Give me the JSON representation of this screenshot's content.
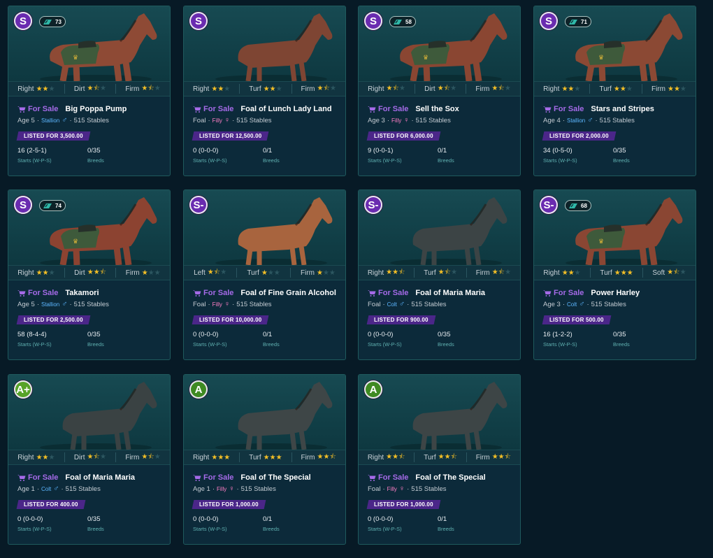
{
  "cards": [
    {
      "grade": "S",
      "rating": "73",
      "prefs": [
        [
          "Right",
          2
        ],
        [
          "Dirt",
          1.5
        ],
        [
          "Firm",
          1.5
        ]
      ],
      "sale": "For Sale",
      "name": "Big Poppa Pump",
      "age": "Age 5",
      "sex": "Stallion",
      "sex_symbol": "♂",
      "stable": "515 Stables",
      "listed": "LISTED FOR 3,500.00",
      "starts": "16 (2-5-1)",
      "starts_label": "Starts (W-P-S)",
      "breeds": "0/35",
      "breeds_label": "Breeds",
      "coat": "#8e4a35",
      "saddle": true
    },
    {
      "grade": "S",
      "rating": "",
      "prefs": [
        [
          "Right",
          2
        ],
        [
          "Turf",
          2
        ],
        [
          "Firm",
          1.5
        ]
      ],
      "sale": "For Sale",
      "name": "Foal of Lunch Lady Land",
      "age": "Foal",
      "sex": "Filly",
      "sex_symbol": "♀",
      "stable": "515 Stables",
      "listed": "LISTED FOR 12,500.00",
      "starts": "0 (0-0-0)",
      "starts_label": "Starts (W-P-S)",
      "breeds": "0/1",
      "breeds_label": "Breeds",
      "coat": "#7e4533",
      "saddle": false
    },
    {
      "grade": "S",
      "rating": "58",
      "prefs": [
        [
          "Right",
          1.5
        ],
        [
          "Dirt",
          1.5
        ],
        [
          "Firm",
          1.5
        ]
      ],
      "sale": "For Sale",
      "name": "Sell the Sox",
      "age": "Age 3",
      "sex": "Filly",
      "sex_symbol": "♀",
      "stable": "515 Stables",
      "listed": "LISTED FOR 6,000.00",
      "starts": "9 (0-0-1)",
      "starts_label": "Starts (W-P-S)",
      "breeds": "0/1",
      "breeds_label": "Breeds",
      "coat": "#8a4632",
      "saddle": true
    },
    {
      "grade": "S",
      "rating": "71",
      "prefs": [
        [
          "Right",
          2
        ],
        [
          "Turf",
          2
        ],
        [
          "Firm",
          2
        ]
      ],
      "sale": "For Sale",
      "name": "Stars and Stripes",
      "age": "Age 4",
      "sex": "Stallion",
      "sex_symbol": "♂",
      "stable": "515 Stables",
      "listed": "LISTED FOR 2,000.00",
      "starts": "34 (0-5-0)",
      "starts_label": "Starts (W-P-S)",
      "breeds": "0/35",
      "breeds_label": "Breeds",
      "coat": "#8b4934",
      "saddle": true
    },
    {
      "grade": "S",
      "rating": "74",
      "prefs": [
        [
          "Right",
          2
        ],
        [
          "Dirt",
          2.5
        ],
        [
          "Firm",
          1
        ]
      ],
      "sale": "For Sale",
      "name": "Takamori",
      "age": "Age 5",
      "sex": "Stallion",
      "sex_symbol": "♂",
      "stable": "515 Stables",
      "listed": "LISTED FOR 2,500.00",
      "starts": "58 (8-4-4)",
      "starts_label": "Starts (W-P-S)",
      "breeds": "0/35",
      "breeds_label": "Breeds",
      "coat": "#8c4331",
      "saddle": true
    },
    {
      "grade": "S-",
      "rating": "",
      "prefs": [
        [
          "Left",
          1.5
        ],
        [
          "Turf",
          1
        ],
        [
          "Firm",
          1
        ]
      ],
      "sale": "For Sale",
      "name": "Foal of Fine Grain Alcohol",
      "age": "Foal",
      "sex": "Filly",
      "sex_symbol": "♀",
      "stable": "515 Stables",
      "listed": "LISTED FOR 10,000.00",
      "starts": "0 (0-0-0)",
      "starts_label": "Starts (W-P-S)",
      "breeds": "0/1",
      "breeds_label": "Breeds",
      "coat": "#a8643e",
      "saddle": false
    },
    {
      "grade": "S-",
      "rating": "",
      "prefs": [
        [
          "Right",
          2.5
        ],
        [
          "Turf",
          1.5
        ],
        [
          "Firm",
          1.5
        ]
      ],
      "sale": "For Sale",
      "name": "Foal of Maria Maria",
      "age": "Foal",
      "sex": "Colt",
      "sex_symbol": "♂",
      "stable": "515 Stables",
      "listed": "LISTED FOR 900.00",
      "starts": "0 (0-0-0)",
      "starts_label": "Starts (W-P-S)",
      "breeds": "0/35",
      "breeds_label": "Breeds",
      "coat": "#3c4445",
      "saddle": false
    },
    {
      "grade": "S-",
      "rating": "68",
      "prefs": [
        [
          "Right",
          2
        ],
        [
          "Turf",
          3
        ],
        [
          "Soft",
          1.5
        ]
      ],
      "sale": "For Sale",
      "name": "Power Harley",
      "age": "Age 3",
      "sex": "Colt",
      "sex_symbol": "♂",
      "stable": "515 Stables",
      "listed": "LISTED FOR 500.00",
      "starts": "16 (1-2-2)",
      "starts_label": "Starts (W-P-S)",
      "breeds": "0/35",
      "breeds_label": "Breeds",
      "coat": "#8a4633",
      "saddle": true
    },
    {
      "grade": "A+",
      "rating": "",
      "prefs": [
        [
          "Right",
          2
        ],
        [
          "Dirt",
          1.5
        ],
        [
          "Firm",
          1.5
        ]
      ],
      "sale": "For Sale",
      "name": "Foal of Maria Maria",
      "age": "Age 1",
      "sex": "Colt",
      "sex_symbol": "♂",
      "stable": "515 Stables",
      "listed": "LISTED FOR 400.00",
      "starts": "0 (0-0-0)",
      "starts_label": "Starts (W-P-S)",
      "breeds": "0/35",
      "breeds_label": "Breeds",
      "coat": "#3a4243",
      "saddle": false
    },
    {
      "grade": "A",
      "rating": "",
      "prefs": [
        [
          "Right",
          3
        ],
        [
          "Turf",
          3
        ],
        [
          "Firm",
          2.5
        ]
      ],
      "sale": "For Sale",
      "name": "Foal of The Special",
      "age": "Age 1",
      "sex": "Filly",
      "sex_symbol": "♀",
      "stable": "515 Stables",
      "listed": "LISTED FOR 1,000.00",
      "starts": "0 (0-0-0)",
      "starts_label": "Starts (W-P-S)",
      "breeds": "0/1",
      "breeds_label": "Breeds",
      "coat": "#3e4647",
      "saddle": false
    },
    {
      "grade": "A",
      "rating": "",
      "prefs": [
        [
          "Right",
          2.5
        ],
        [
          "Turf",
          2.5
        ],
        [
          "Firm",
          2.5
        ]
      ],
      "sale": "For Sale",
      "name": "Foal of The Special",
      "age": "Foal",
      "sex": "Filly",
      "sex_symbol": "♀",
      "stable": "515 Stables",
      "listed": "LISTED FOR 1,000.00",
      "starts": "0 (0-0-0)",
      "starts_label": "Starts (W-P-S)",
      "breeds": "0/1",
      "breeds_label": "Breeds",
      "coat": "#3d4546",
      "saddle": false
    }
  ],
  "colors": {
    "accent_purple": "#a56ae8",
    "listed_bg": "#4b2689",
    "star": "#f4bf26",
    "male": "#5cb6ff",
    "female": "#ff7fc6"
  }
}
